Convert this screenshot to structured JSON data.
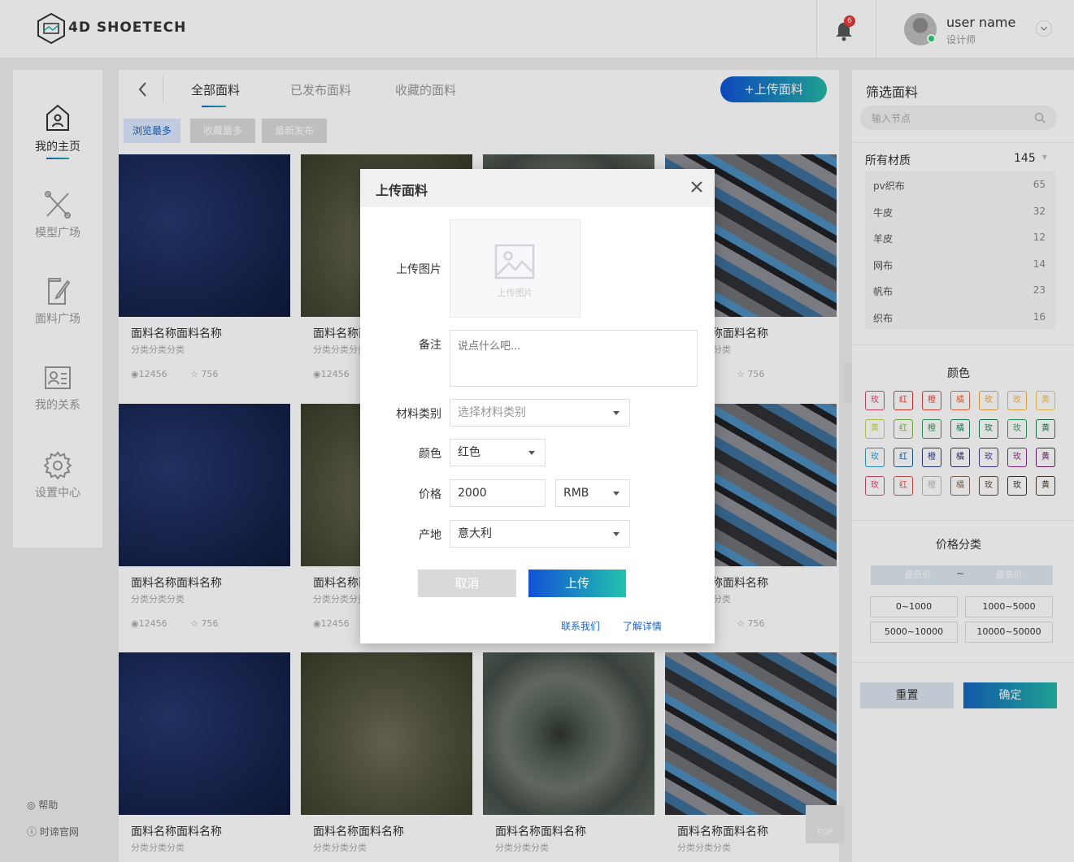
{
  "header": {
    "logo": "4D SHOETECH",
    "notifications": "6",
    "user_name": "user name",
    "user_role": "设计师"
  },
  "sidebar": {
    "items": [
      {
        "label": "我的主页"
      },
      {
        "label": "模型广场"
      },
      {
        "label": "面料广场"
      },
      {
        "label": "我的关系"
      },
      {
        "label": "设置中心"
      }
    ],
    "footer": {
      "help": "帮助",
      "site": "时谛官网"
    }
  },
  "main": {
    "tabs": [
      "全部面料",
      "已发布面料",
      "收藏的面料"
    ],
    "upload_button": "+上传面料",
    "sort_chips": [
      "浏览最多",
      "收藏最多",
      "最新发布"
    ],
    "card": {
      "title": "面料名称面料名称",
      "subtitle": "分类分类分类",
      "views": "12456",
      "likes": "756"
    },
    "back_to_top": "TOP"
  },
  "filter": {
    "title": "筛选面料",
    "search_placeholder": "输入节点",
    "materials_label": "所有材质",
    "materials_total": "145",
    "materials": [
      {
        "name": "pv织布",
        "count": "65"
      },
      {
        "name": "牛皮",
        "count": "32"
      },
      {
        "name": "羊皮",
        "count": "12"
      },
      {
        "name": "网布",
        "count": "14"
      },
      {
        "name": "帆布",
        "count": "23"
      },
      {
        "name": "织布",
        "count": "16"
      }
    ],
    "color_title": "颜色",
    "color_rows": [
      [
        {
          "t": "玫",
          "c": "#e0457b"
        },
        {
          "t": "红",
          "c": "#e53935"
        },
        {
          "t": "橙",
          "c": "#e8463a"
        },
        {
          "t": "橘",
          "c": "#ef6c3a"
        },
        {
          "t": "玫",
          "c": "#f2a641"
        },
        {
          "t": "玫",
          "c": "#f5b642"
        },
        {
          "t": "黄",
          "c": "#f2c94c"
        }
      ],
      [
        {
          "t": "黄",
          "c": "#c6d64a"
        },
        {
          "t": "红",
          "c": "#7db544"
        },
        {
          "t": "橙",
          "c": "#2e9e5b"
        },
        {
          "t": "橘",
          "c": "#1b8a5a"
        },
        {
          "t": "玫",
          "c": "#1f7a4c"
        },
        {
          "t": "玫",
          "c": "#27a064"
        },
        {
          "t": "黄",
          "c": "#1d7a4a"
        }
      ],
      [
        {
          "t": "玫",
          "c": "#2a9fd6"
        },
        {
          "t": "红",
          "c": "#1a5fa8"
        },
        {
          "t": "橙",
          "c": "#2c3e8f"
        },
        {
          "t": "橘",
          "c": "#333366"
        },
        {
          "t": "玫",
          "c": "#4a3a8f"
        },
        {
          "t": "玫",
          "c": "#8e2a8f"
        },
        {
          "t": "黄",
          "c": "#6a1b6a"
        }
      ],
      [
        {
          "t": "玫",
          "c": "#e0457b"
        },
        {
          "t": "红",
          "c": "#d9534f"
        },
        {
          "t": "橙",
          "c": "#b8b8b8"
        },
        {
          "t": "橘",
          "c": "#8a6d5a"
        },
        {
          "t": "玫",
          "c": "#5a4a3a"
        },
        {
          "t": "玫",
          "c": "#333333"
        },
        {
          "t": "黄",
          "c": "#4a3a2a"
        }
      ]
    ],
    "price_title": "价格分类",
    "price_min_placeholder": "最低价",
    "price_max_placeholder": "最高价",
    "price_tilde": "~",
    "price_ranges": [
      "0~1000",
      "1000~5000",
      "5000~10000",
      "10000~50000"
    ],
    "reset": "重置",
    "confirm": "确定"
  },
  "modal": {
    "title": "上传面料",
    "upload_image_label": "上传图片",
    "upload_image_hint": "上传图片",
    "remark_label": "备注",
    "remark_placeholder": "说点什么吧...",
    "category_label": "材料类别",
    "category_placeholder": "选择材料类别",
    "color_label": "颜色",
    "color_value": "红色",
    "price_label": "价格",
    "price_value": "2000",
    "currency_value": "RMB",
    "origin_label": "产地",
    "origin_value": "意大利",
    "cancel": "取消",
    "upload": "上传",
    "contact": "联系我们",
    "details": "了解详情"
  }
}
